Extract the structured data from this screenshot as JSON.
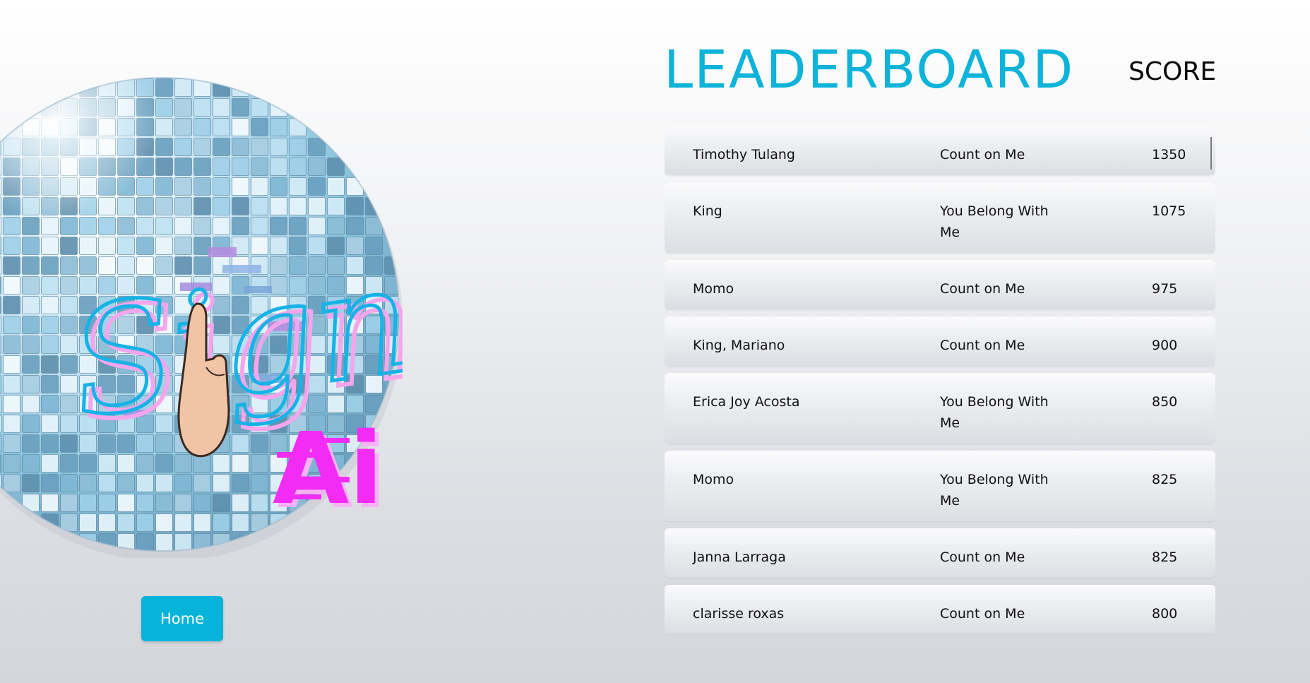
{
  "header": {
    "title": "LEADERBOARD",
    "score_label": "SCORE"
  },
  "logo": {
    "text_primary": "Signif",
    "text_secondary": "Ai"
  },
  "nav": {
    "home_label": "Home"
  },
  "colors": {
    "accent": "#06b4da",
    "logo_pink": "#f32cf5",
    "logo_blue": "#17b2e6"
  },
  "leaderboard": [
    {
      "name": "Timothy Tulang",
      "song": "Count on Me",
      "score": "1350"
    },
    {
      "name": "King",
      "song": "You Belong With Me",
      "score": "1075"
    },
    {
      "name": "Momo",
      "song": "Count on Me",
      "score": "975"
    },
    {
      "name": "King, Mariano",
      "song": "Count on Me",
      "score": "900"
    },
    {
      "name": "Erica Joy Acosta",
      "song": "You Belong With Me",
      "score": "850"
    },
    {
      "name": "Momo",
      "song": "You Belong With Me",
      "score": "825"
    },
    {
      "name": "Janna Larraga",
      "song": "Count on Me",
      "score": "825"
    },
    {
      "name": "clarisse roxas",
      "song": "Count on Me",
      "score": "800"
    }
  ]
}
